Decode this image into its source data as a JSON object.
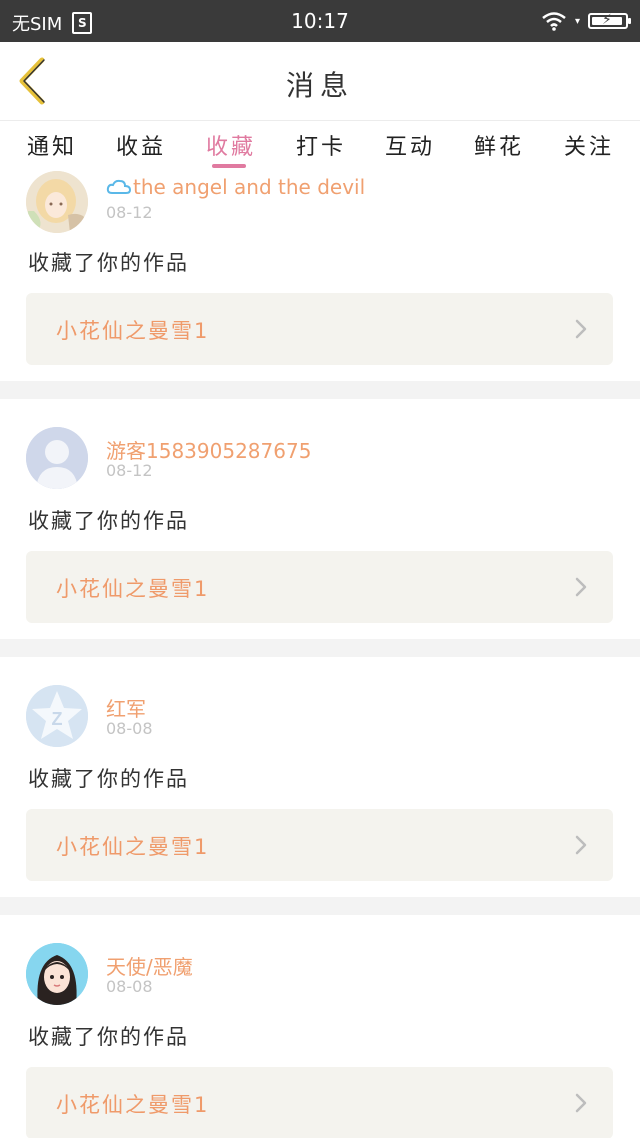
{
  "status_bar": {
    "carrier": "无SIM",
    "sim_icon": "S",
    "time": "10:17"
  },
  "header": {
    "title": "消息"
  },
  "tabs": [
    {
      "label": "通知",
      "active": false
    },
    {
      "label": "收益",
      "active": false
    },
    {
      "label": "收藏",
      "active": true
    },
    {
      "label": "打卡",
      "active": false
    },
    {
      "label": "互动",
      "active": false
    },
    {
      "label": "鲜花",
      "active": false
    },
    {
      "label": "关注",
      "active": false
    }
  ],
  "messages": [
    {
      "username": "the angel and the devil",
      "date": "08-12",
      "action": "收藏了你的作品",
      "work_title": "小花仙之曼雪1",
      "avatar": "anime-girl-avatar"
    },
    {
      "username": "游客1583905287675",
      "date": "08-12",
      "action": "收藏了你的作品",
      "work_title": "小花仙之曼雪1",
      "avatar": "default-person-avatar"
    },
    {
      "username": "红军",
      "date": "08-08",
      "action": "收藏了你的作品",
      "work_title": "小花仙之曼雪1",
      "avatar": "qzone-star-avatar"
    },
    {
      "username": "天使/恶魔",
      "date": "08-08",
      "action": "收藏了你的作品",
      "work_title": "小花仙之曼雪1",
      "avatar": "cartoon-girl-avatar"
    }
  ],
  "colors": {
    "accent": "#e07aa0",
    "username": "#f0a070",
    "work_title": "#ef9a6a",
    "back_icon": "#e6c13a"
  }
}
